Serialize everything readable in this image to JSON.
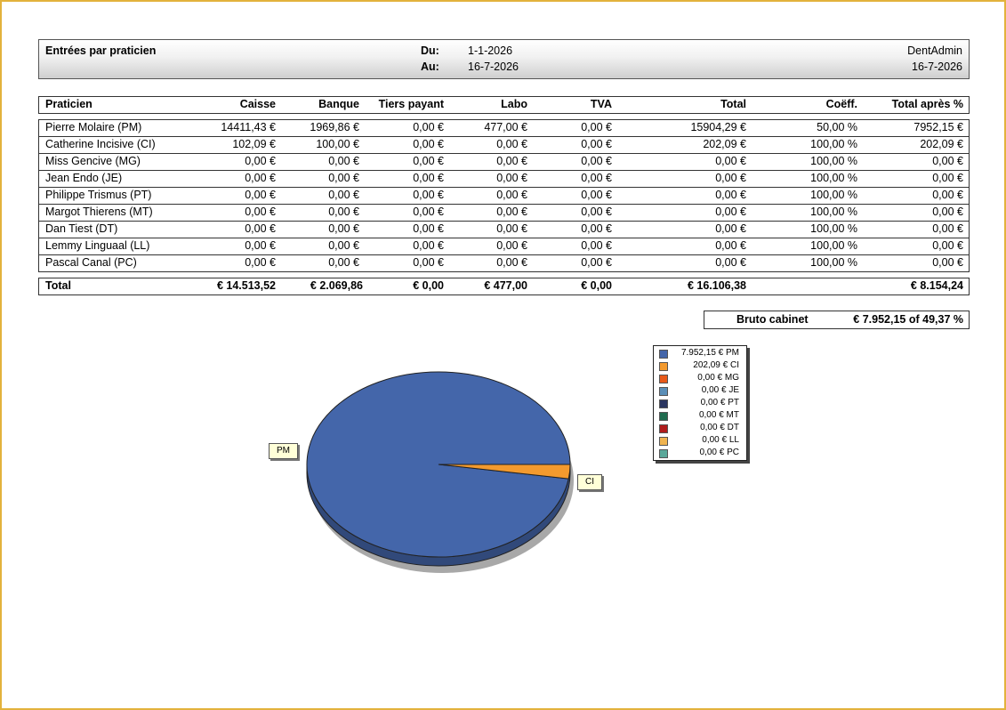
{
  "header": {
    "title": "Entrées par praticien",
    "from_label": "Du:",
    "from_value": "1-1-2026",
    "to_label": "Au:",
    "to_value": "16-7-2026",
    "user": "DentAdmin",
    "date": "16-7-2026"
  },
  "columns": [
    "Praticien",
    "Caisse",
    "Banque",
    "Tiers payant",
    "Labo",
    "TVA",
    "Total",
    "Coëff.",
    "Total après %"
  ],
  "rows": [
    [
      "Pierre Molaire (PM)",
      "14411,43 €",
      "1969,86 €",
      "0,00 €",
      "477,00 €",
      "0,00 €",
      "15904,29 €",
      "50,00 %",
      "7952,15 €"
    ],
    [
      "Catherine Incisive (CI)",
      "102,09 €",
      "100,00 €",
      "0,00 €",
      "0,00 €",
      "0,00 €",
      "202,09 €",
      "100,00 %",
      "202,09 €"
    ],
    [
      "Miss Gencive (MG)",
      "0,00 €",
      "0,00 €",
      "0,00 €",
      "0,00 €",
      "0,00 €",
      "0,00 €",
      "100,00 %",
      "0,00 €"
    ],
    [
      "Jean Endo (JE)",
      "0,00 €",
      "0,00 €",
      "0,00 €",
      "0,00 €",
      "0,00 €",
      "0,00 €",
      "100,00 %",
      "0,00 €"
    ],
    [
      "Philippe Trismus (PT)",
      "0,00 €",
      "0,00 €",
      "0,00 €",
      "0,00 €",
      "0,00 €",
      "0,00 €",
      "100,00 %",
      "0,00 €"
    ],
    [
      "Margot Thierens (MT)",
      "0,00 €",
      "0,00 €",
      "0,00 €",
      "0,00 €",
      "0,00 €",
      "0,00 €",
      "100,00 %",
      "0,00 €"
    ],
    [
      "Dan Tiest (DT)",
      "0,00 €",
      "0,00 €",
      "0,00 €",
      "0,00 €",
      "0,00 €",
      "0,00 €",
      "100,00 %",
      "0,00 €"
    ],
    [
      "Lemmy Linguaal (LL)",
      "0,00 €",
      "0,00 €",
      "0,00 €",
      "0,00 €",
      "0,00 €",
      "0,00 €",
      "100,00 %",
      "0,00 €"
    ],
    [
      "Pascal Canal (PC)",
      "0,00 €",
      "0,00 €",
      "0,00 €",
      "0,00 €",
      "0,00 €",
      "0,00 €",
      "100,00 %",
      "0,00 €"
    ]
  ],
  "totals": {
    "label": "Total",
    "caisse": "€ 14.513,52",
    "banque": "€ 2.069,86",
    "tiers": "€ 0,00",
    "labo": "€ 477,00",
    "tva": "€ 0,00",
    "total": "€ 16.106,38",
    "after": "€ 8.154,24"
  },
  "bruto": {
    "label": "Bruto cabinet",
    "value": "€ 7.952,15 of 49,37 %"
  },
  "legend": [
    {
      "text": "7.952,15 € PM",
      "color": "#4466aa"
    },
    {
      "text": "202,09 € CI",
      "color": "#f39a2e"
    },
    {
      "text": "0,00 € MG",
      "color": "#e85a1a"
    },
    {
      "text": "0,00 € JE",
      "color": "#5b8fb8"
    },
    {
      "text": "0,00 € PT",
      "color": "#2a3560"
    },
    {
      "text": "0,00 € MT",
      "color": "#1f6b4e"
    },
    {
      "text": "0,00 € DT",
      "color": "#b01c1c"
    },
    {
      "text": "0,00 € LL",
      "color": "#f0b450"
    },
    {
      "text": "0,00 € PC",
      "color": "#5aa89a"
    }
  ],
  "chart_data": {
    "type": "pie",
    "categories": [
      "PM",
      "CI",
      "MG",
      "JE",
      "PT",
      "MT",
      "DT",
      "LL",
      "PC"
    ],
    "values": [
      7952.15,
      202.09,
      0,
      0,
      0,
      0,
      0,
      0,
      0
    ],
    "colors": [
      "#4466aa",
      "#f39a2e",
      "#e85a1a",
      "#5b8fb8",
      "#2a3560",
      "#1f6b4e",
      "#b01c1c",
      "#f0b450",
      "#5aa89a"
    ],
    "callouts": [
      "PM",
      "CI"
    ],
    "legend_position": "right"
  }
}
